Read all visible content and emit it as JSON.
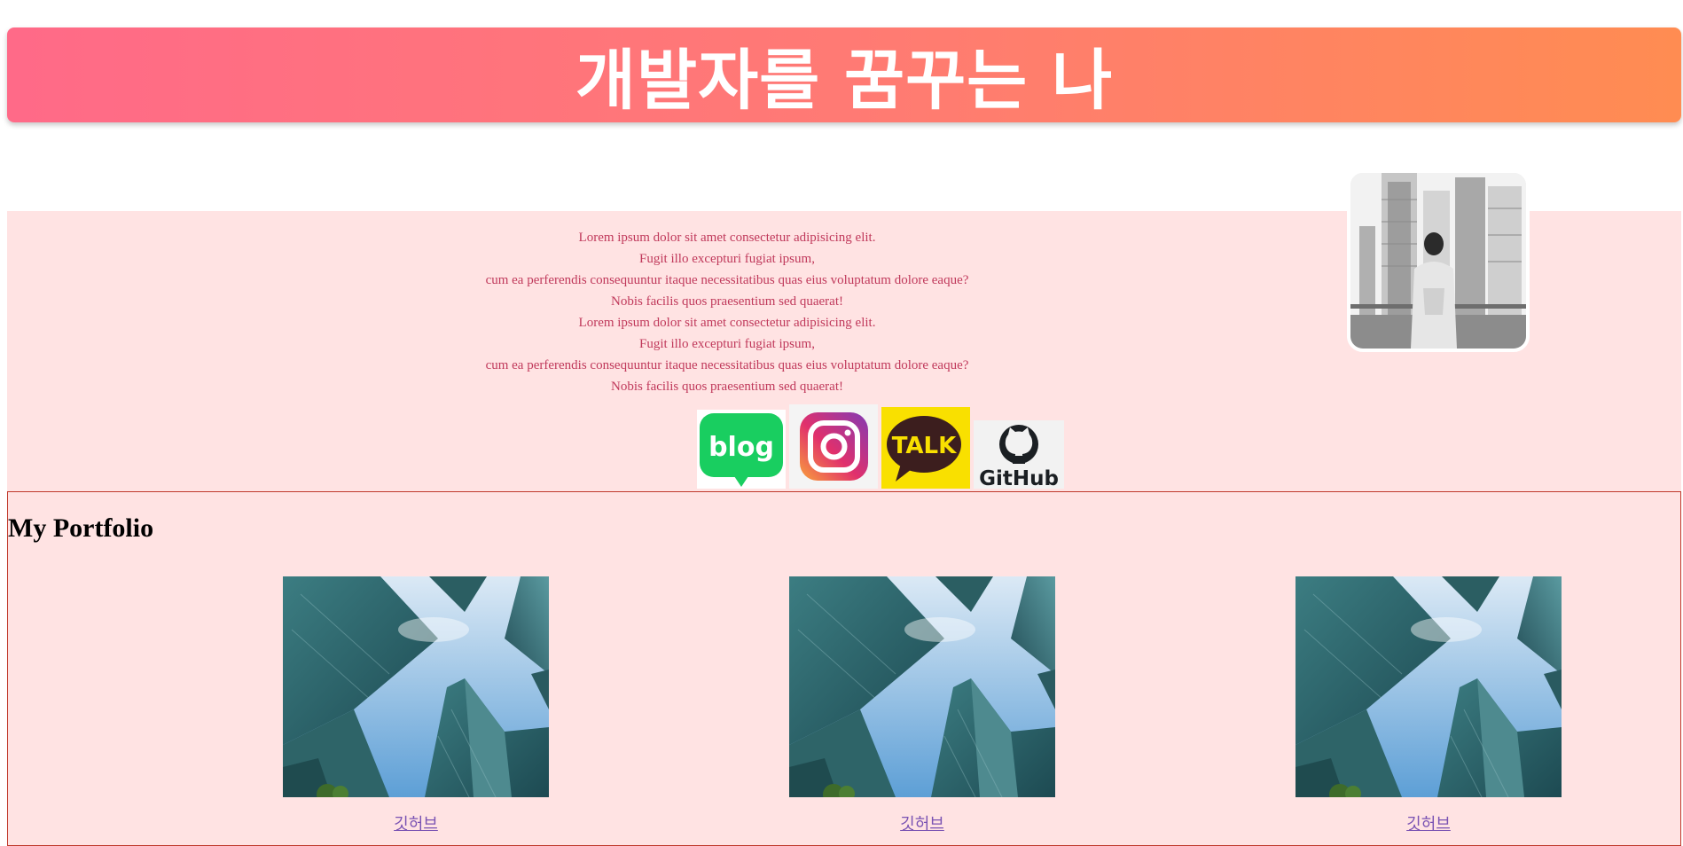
{
  "header": {
    "title": "개발자를 꿈꾸는 나"
  },
  "about": {
    "lines": [
      "Lorem ipsum dolor sit amet consectetur adipisicing elit.",
      "Fugit illo excepturi fugiat ipsum,",
      "cum ea perferendis consequuntur itaque necessitatibus quas eius voluptatum dolore eaque?",
      "Nobis facilis quos praesentium sed quaerat!",
      "Lorem ipsum dolor sit amet consectetur adipisicing elit.",
      "Fugit illo excepturi fugiat ipsum,",
      "cum ea perferendis consequuntur itaque necessitatibus quas eius voluptatum dolore eaque?",
      "Nobis facilis quos praesentium sed quaerat!"
    ]
  },
  "socials": {
    "blog": {
      "text": "blog",
      "icon": "naver-blog-icon",
      "color": "#19ce60"
    },
    "instagram": {
      "icon": "instagram-icon"
    },
    "kakao": {
      "text": "TALK",
      "icon": "kakaotalk-icon",
      "color": "#f9e000"
    },
    "github": {
      "text": "GitHub",
      "icon": "github-icon"
    }
  },
  "portfolio": {
    "title": "My Portfolio",
    "items": [
      {
        "link": "깃허브"
      },
      {
        "link": "깃허브"
      },
      {
        "link": "깃허브"
      }
    ]
  },
  "colors": {
    "header_gradient_start": "#ff6a88",
    "header_gradient_end": "#ff8c52",
    "section_bg": "#ffe3e3",
    "bio_text": "#c0395b",
    "portfolio_border": "#c0392b"
  }
}
